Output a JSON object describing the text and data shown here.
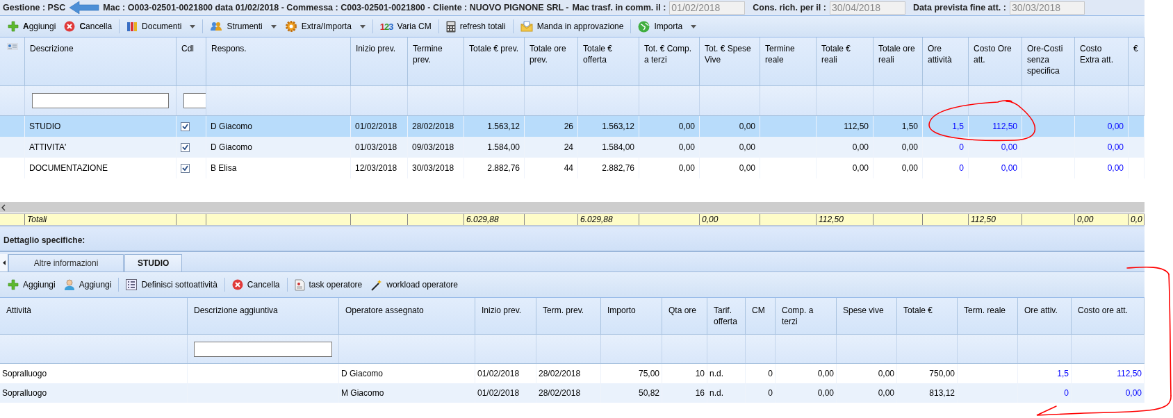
{
  "header": {
    "title": "Gestione : PSC",
    "info": "Mac : O003-02501-0021800 data 01/02/2018 - Commessa : C003-02501-0021800 - Cliente : NUOVO PIGNONE SRL -",
    "fields": [
      {
        "label": "Mac trasf. in comm. il :",
        "value": "01/02/2018",
        "disabled": true
      },
      {
        "label": "Cons. rich. per il :",
        "value": "30/04/2018",
        "disabled": true
      },
      {
        "label": "Data prevista fine att. :",
        "value": "30/03/2018",
        "disabled": true
      }
    ]
  },
  "toolbar": [
    {
      "label": "**A**ggiungi",
      "dropdown": false,
      "separator_before": false
    },
    {
      "label": "**C**ancella",
      "dropdown": false,
      "separator_before": false
    },
    {
      "label": "Documenti",
      "dropdown": true,
      "separator_before": true
    },
    {
      "label": "Strumenti",
      "dropdown": true,
      "separator_before": true
    },
    {
      "label": "Extra/Importa",
      "dropdown": true,
      "separator_before": false
    },
    {
      "label": "Varia CM",
      "icon_text": "123",
      "dropdown": false,
      "separator_before": true
    },
    {
      "label": "refresh totali",
      "dropdown": false,
      "separator_before": true
    },
    {
      "label": "Manda in approvazione",
      "dropdown": false,
      "separator_before": true
    },
    {
      "label": "Importa",
      "dropdown": true,
      "separator_before": true
    }
  ],
  "grid": {
    "columns": [
      {
        "label": "Descrizione",
        "kind": "text",
        "filter": true,
        "total": "Totali"
      },
      {
        "label": "Cdl",
        "kind": "check",
        "filter": true
      },
      {
        "label": "Respons.",
        "kind": "text",
        "filter": false
      },
      {
        "label": "Inizio prev.",
        "kind": "text",
        "filter": false
      },
      {
        "label": "Termine prev.",
        "kind": "text",
        "filter": false
      },
      {
        "label": "Totale € prev.",
        "kind": "number",
        "filter": false,
        "total": "6.029,88"
      },
      {
        "label": "Totale ore prev.",
        "kind": "number",
        "filter": false
      },
      {
        "label": "Totale € offerta",
        "kind": "number",
        "filter": false,
        "total": "6.029,88"
      },
      {
        "label": "Tot. € Comp. a terzi",
        "kind": "number",
        "filter": false
      },
      {
        "label": "Tot. € Spese Vive",
        "kind": "number",
        "filter": false,
        "total": "0,00"
      },
      {
        "label": "Termine reale",
        "kind": "text",
        "filter": false
      },
      {
        "label": "Totale € reali",
        "kind": "number",
        "filter": false,
        "total": "112,50"
      },
      {
        "label": "Totale ore reali",
        "kind": "number",
        "filter": false
      },
      {
        "label": "Ore attività",
        "kind": "link",
        "filter": false
      },
      {
        "label": "Costo Ore att.",
        "kind": "link",
        "filter": false,
        "total": "112,50"
      },
      {
        "label": "Ore-Costi senza specifica",
        "kind": "text",
        "filter": false
      },
      {
        "label": "Costo Extra att.",
        "kind": "link",
        "filter": false,
        "total": "0,00"
      },
      {
        "label": "€",
        "kind": "text",
        "filter": false,
        "total": "0,0"
      }
    ],
    "rows": [
      {
        "selected": true,
        "cells": [
          "STUDIO",
          {
            "checked": true
          },
          "D Giacomo",
          "01/02/2018",
          "28/02/2018",
          "1.563,12",
          "26",
          "1.563,12",
          "0,00",
          "0,00",
          null,
          "112,50",
          "1,50",
          "1,5",
          "112,50",
          null,
          "0,00",
          null
        ]
      },
      {
        "selected": false,
        "cells": [
          "ATTIVITA'",
          {
            "checked": true
          },
          "D Giacomo",
          "01/03/2018",
          "09/03/2018",
          "1.584,00",
          "24",
          "1.584,00",
          "0,00",
          "0,00",
          null,
          "0,00",
          "0,00",
          "0",
          "0,00",
          null,
          "0,00",
          null
        ]
      },
      {
        "selected": false,
        "cells": [
          "DOCUMENTAZIONE",
          {
            "checked": true
          },
          "B Elisa",
          "12/03/2018",
          "30/03/2018",
          "2.882,76",
          "44",
          "2.882,76",
          "0,00",
          "0,00",
          null,
          "0,00",
          "0,00",
          "0",
          "0,00",
          null,
          "0,00",
          null
        ]
      }
    ]
  },
  "detail": {
    "title": "Dettaglio specifiche:",
    "tabs": [
      {
        "label": "Altre informazioni",
        "selected": false
      },
      {
        "label": "STUDIO",
        "selected": true
      }
    ],
    "toolbar": [
      {
        "label": "Aggiungi",
        "dropdown": false,
        "separator_before": false
      },
      {
        "label": "Aggiungi",
        "dropdown": false,
        "separator_before": false
      },
      {
        "label": "Definisci sottoattività",
        "dropdown": false,
        "separator_before": true
      },
      {
        "label": "Cancella",
        "dropdown": false,
        "separator_before": true
      },
      {
        "label": "task operatore",
        "dropdown": false,
        "separator_before": true
      },
      {
        "label": "workload operatore",
        "dropdown": false,
        "separator_before": false
      }
    ],
    "grid": {
      "columns": [
        {
          "label": "Attività",
          "kind": "text",
          "filter": false
        },
        {
          "label": "Descrizione aggiuntiva",
          "kind": "text",
          "filter": true
        },
        {
          "label": "Operatore assegnato",
          "kind": "text",
          "filter": false
        },
        {
          "label": "Inizio prev.",
          "kind": "text",
          "filter": false
        },
        {
          "label": "Term. prev.",
          "kind": "text",
          "filter": false
        },
        {
          "label": "Importo",
          "kind": "number",
          "filter": false
        },
        {
          "label": "Qta ore",
          "kind": "number",
          "filter": false
        },
        {
          "label": "Tarif. offerta",
          "kind": "text",
          "filter": false
        },
        {
          "label": "CM",
          "kind": "number",
          "filter": false
        },
        {
          "label": "Comp. a terzi",
          "kind": "number",
          "filter": false
        },
        {
          "label": "Spese vive",
          "kind": "number",
          "filter": false
        },
        {
          "label": "Totale €",
          "kind": "number",
          "filter": false
        },
        {
          "label": "Term. reale",
          "kind": "text",
          "filter": false
        },
        {
          "label": "Ore attiv.",
          "kind": "link",
          "filter": false
        },
        {
          "label": "Costo ore att.",
          "kind": "link",
          "filter": false
        }
      ],
      "rows": [
        {
          "selected": false,
          "cells": [
            "Sopralluogo",
            null,
            "D Giacomo",
            "01/02/2018",
            "28/02/2018",
            "75,00",
            "10",
            "n.d.",
            "0",
            "0,00",
            "0,00",
            "750,00",
            null,
            "1,5",
            "112,50"
          ]
        },
        {
          "selected": false,
          "cells": [
            "Sopralluogo",
            null,
            "M Giacomo",
            "01/02/2018",
            "28/02/2018",
            "50,82",
            "16",
            "n.d.",
            "0",
            "0,00",
            "0,00",
            "813,12",
            null,
            "0",
            "0,00"
          ]
        }
      ]
    }
  }
}
